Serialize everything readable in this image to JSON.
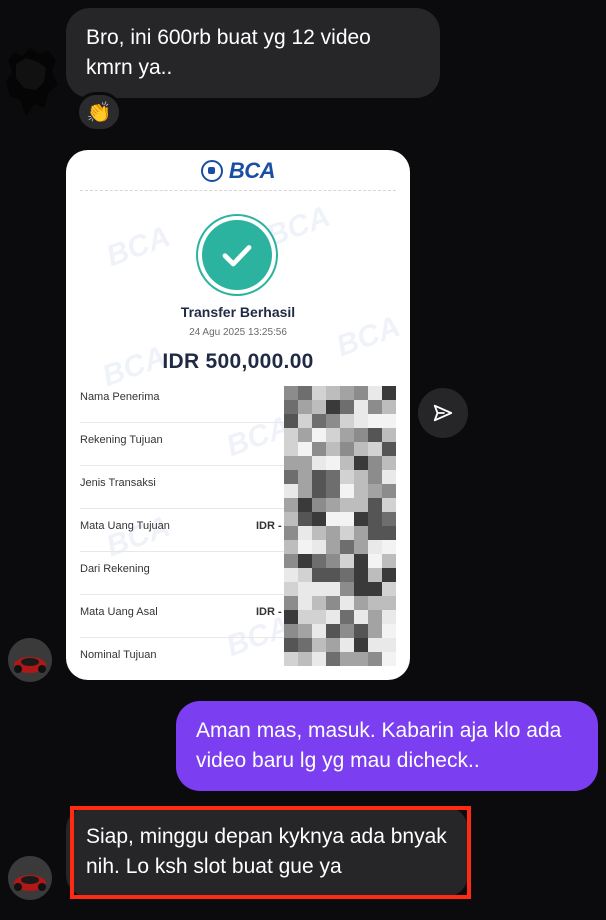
{
  "messages": {
    "first": "Bro, ini 600rb buat yg 12 video kmrn ya..",
    "reply": "Aman mas, masuk. Kabarin aja klo ada video baru lg yg mau dicheck..",
    "last": "Siap, minggu depan kyknya ada bnyak nih. Lo ksh slot buat gue ya"
  },
  "reaction": {
    "emoji": "👏",
    "icon": "clapping-hands-icon"
  },
  "receipt": {
    "bank_logo": "BCA",
    "status": "Transfer Berhasil",
    "datetime": "24 Agu 2025 13:25:56",
    "amount": "IDR 500,000.00",
    "rows": [
      {
        "label": "Nama Penerima",
        "value": ""
      },
      {
        "label": "Rekening Tujuan",
        "value": ""
      },
      {
        "label": "Jenis Transaksi",
        "value": ""
      },
      {
        "label": "Mata Uang Tujuan",
        "value": "IDR -"
      },
      {
        "label": "Dari Rekening",
        "value": ""
      },
      {
        "label": "Mata Uang Asal",
        "value": "IDR -"
      },
      {
        "label": "Nominal Tujuan",
        "value": ""
      }
    ]
  },
  "icons": {
    "share": "send-icon",
    "check": "check-circle-icon"
  },
  "colors": {
    "background": "#0b0b0d",
    "incoming_bubble": "#262629",
    "outgoing_bubble": "#7b3ef0",
    "bca_blue": "#1a4ea3",
    "success_teal": "#2bb3a0",
    "highlight_red": "#ff2a14"
  }
}
